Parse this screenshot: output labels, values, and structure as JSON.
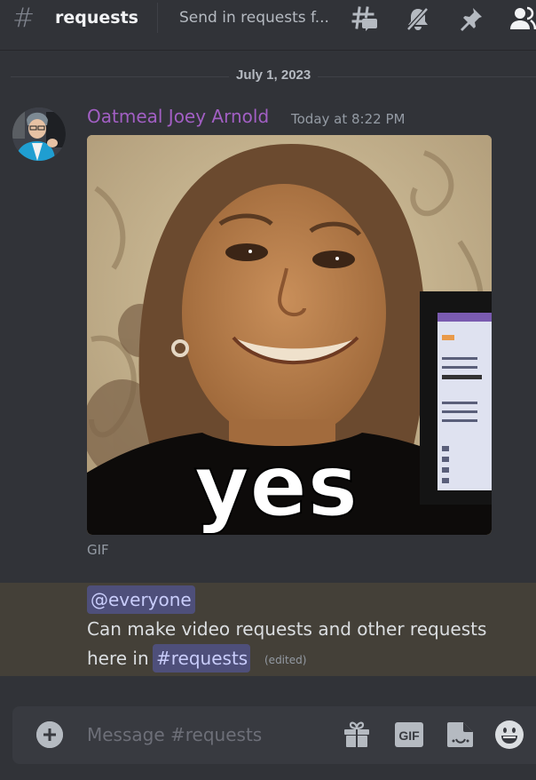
{
  "header": {
    "channel_hash": "#",
    "channel_name": "requests",
    "topic": "Send in requests f...",
    "icons": [
      "threads-icon",
      "mute-bell-icon",
      "pin-icon",
      "member-list-icon"
    ]
  },
  "date_divider": "July 1, 2023",
  "message": {
    "author": "Oatmeal Joey Arnold",
    "author_color": "#a25fc4",
    "timestamp": "Today at 8:22 PM",
    "attachment": {
      "type": "GIF",
      "overlay_text": "yes",
      "caption": "GIF"
    }
  },
  "mention_message": {
    "mention": "@everyone",
    "line1": "Can make video requests and other requests",
    "line2_prefix": "here in",
    "channel_mention": "#requests",
    "edited": "(edited)",
    "highlight_color": "#444038"
  },
  "composer": {
    "placeholder": "Message #requests",
    "value": "",
    "gif_label": "GIF",
    "buttons": [
      "add-attachment",
      "gift",
      "gif",
      "sticker",
      "emoji"
    ]
  }
}
